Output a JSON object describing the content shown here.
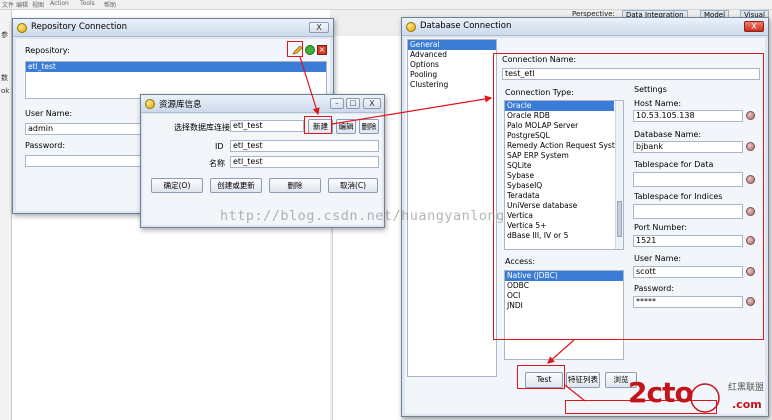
{
  "background": {
    "menu": [
      "文件",
      "编辑",
      "视图",
      "Action",
      "Tools",
      "帮助"
    ],
    "side_chars": [
      "参",
      "数",
      "ok"
    ],
    "perspective_label": "Perspective:",
    "data_tab": "Data Integration",
    "model_tab": "Model",
    "visual_tab": "Visual"
  },
  "repo_conn": {
    "title": "Repository Connection",
    "repository_label": "Repository:",
    "repositories": [
      "etl_test"
    ],
    "username_label": "User Name:",
    "username": "admin",
    "password_label": "Password:",
    "close": "X"
  },
  "repo_info": {
    "title": "资源库信息",
    "select_label": "选择数据库连接",
    "connection": "etl_test",
    "new_btn": "新建",
    "edit_btn": "编辑",
    "delete_top_btn": "删除",
    "id_label": "ID",
    "id_value": "etl_test",
    "name_label": "名称",
    "name_value": "etl_test",
    "ok_btn": "确定(O)",
    "create_btn": "创建或更新",
    "delete_btn": "删除",
    "cancel_btn": "取消(C)",
    "close": "X"
  },
  "db_conn": {
    "title": "Database Connection",
    "close": "X",
    "nav": [
      "General",
      "Advanced",
      "Options",
      "Pooling",
      "Clustering"
    ],
    "conn_name_label": "Connection Name:",
    "conn_name": "test_etl",
    "conn_type_label": "Connection Type:",
    "conn_types": [
      "Oracle",
      "Oracle RDB",
      "Palo MOLAP Server",
      "PostgreSQL",
      "Remedy Action Request System",
      "SAP ERP System",
      "SQLite",
      "Sybase",
      "SybaseIQ",
      "Teradata",
      "UniVerse database",
      "Vertica",
      "Vertica 5+",
      "dBase III, IV or 5"
    ],
    "access_label": "Access:",
    "access_types": [
      "Native (JDBC)",
      "ODBC",
      "OCI",
      "JNDI"
    ],
    "settings_label": "Settings",
    "host_label": "Host Name:",
    "host": "10.53.105.138",
    "dbname_label": "Database Name:",
    "dbname": "bjbank",
    "ts_data_label": "Tablespace for Data",
    "ts_data": "",
    "ts_index_label": "Tablespace for Indices",
    "ts_index": "",
    "port_label": "Port Number:",
    "port": "1521",
    "user_label": "User Name:",
    "user": "scott",
    "pass_label": "Password:",
    "pass": "*****",
    "test_btn": "Test",
    "feature_btn": "特征列表",
    "browse_btn": "浏览"
  },
  "overlay": {
    "watermark": "http://blog.csdn.net/huangyanlong",
    "brand_main": "2cto",
    "brand_cn": "红黑联盟",
    "brand_com": ".com"
  }
}
